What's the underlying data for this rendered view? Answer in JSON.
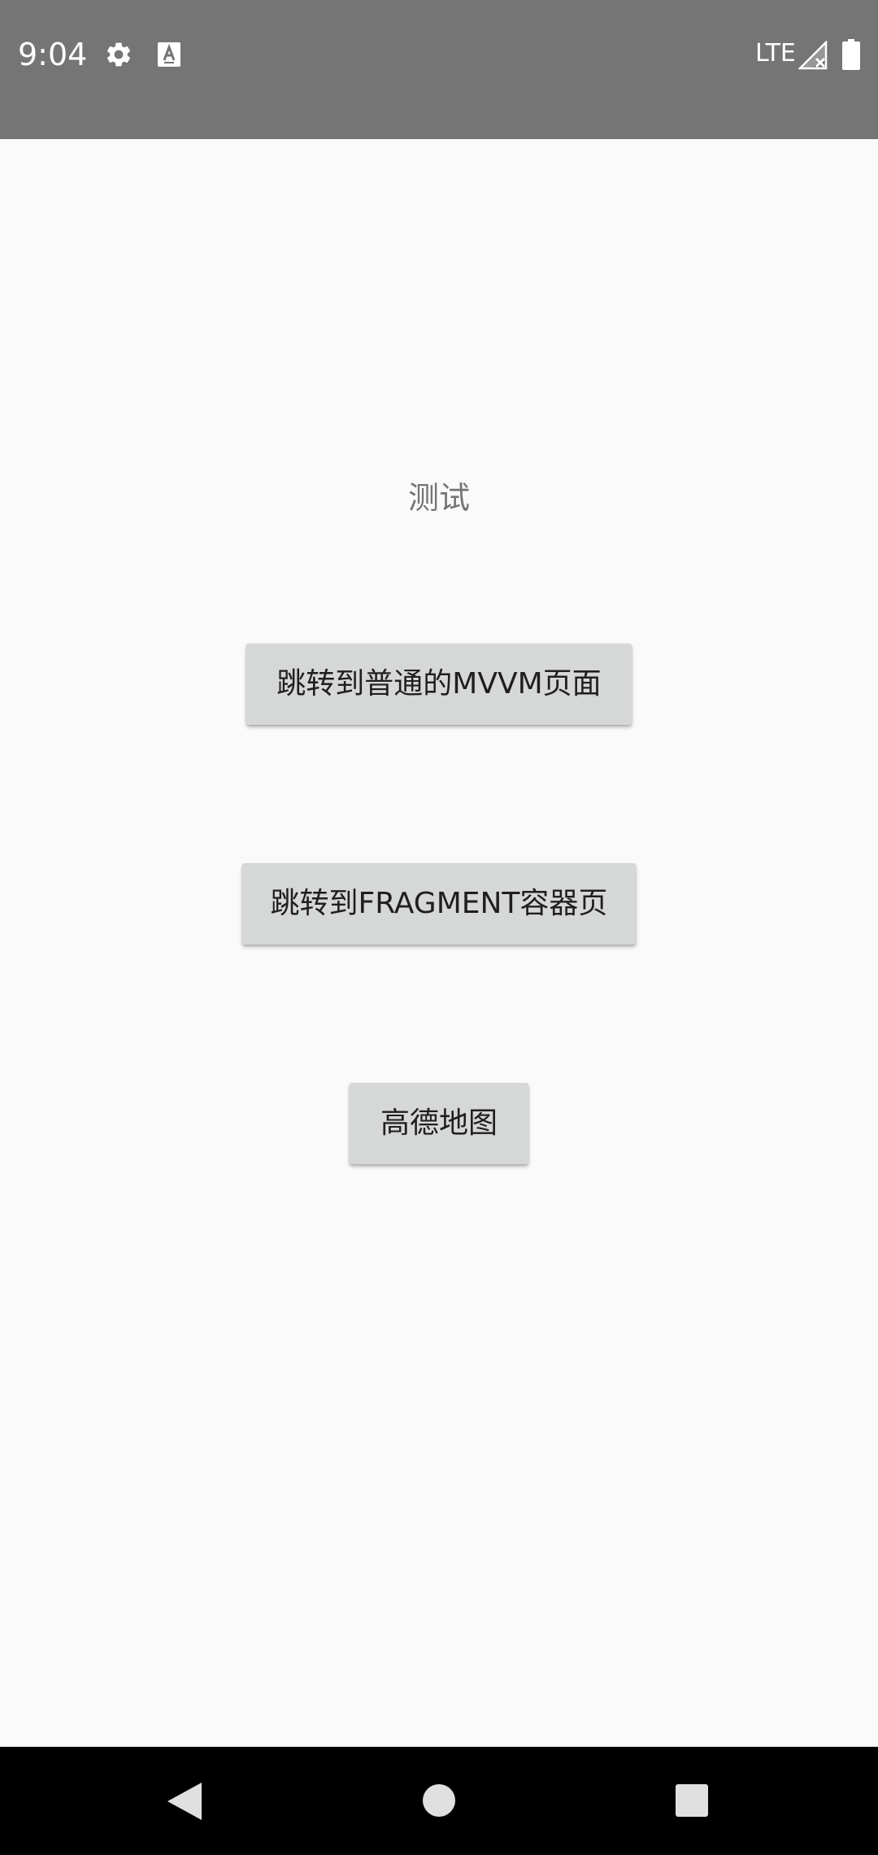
{
  "status_bar": {
    "time": "9:04",
    "network": "LTE",
    "icons": [
      "gear-icon",
      "text-a-icon",
      "signal-icon",
      "battery-icon"
    ]
  },
  "main": {
    "title": "测试",
    "buttons": [
      {
        "label": "跳转到普通的MVVM页面"
      },
      {
        "label": "跳转到FRAGMENT容器页"
      },
      {
        "label": "高德地图"
      }
    ]
  },
  "nav_bar": {
    "icons": [
      "back-icon",
      "home-icon",
      "recents-icon"
    ]
  },
  "colors": {
    "status_bar_bg": "#757575",
    "page_bg": "#fafafa",
    "button_bg": "#d6d7d7",
    "title_text": "#757575",
    "nav_bar_bg": "#000000"
  }
}
